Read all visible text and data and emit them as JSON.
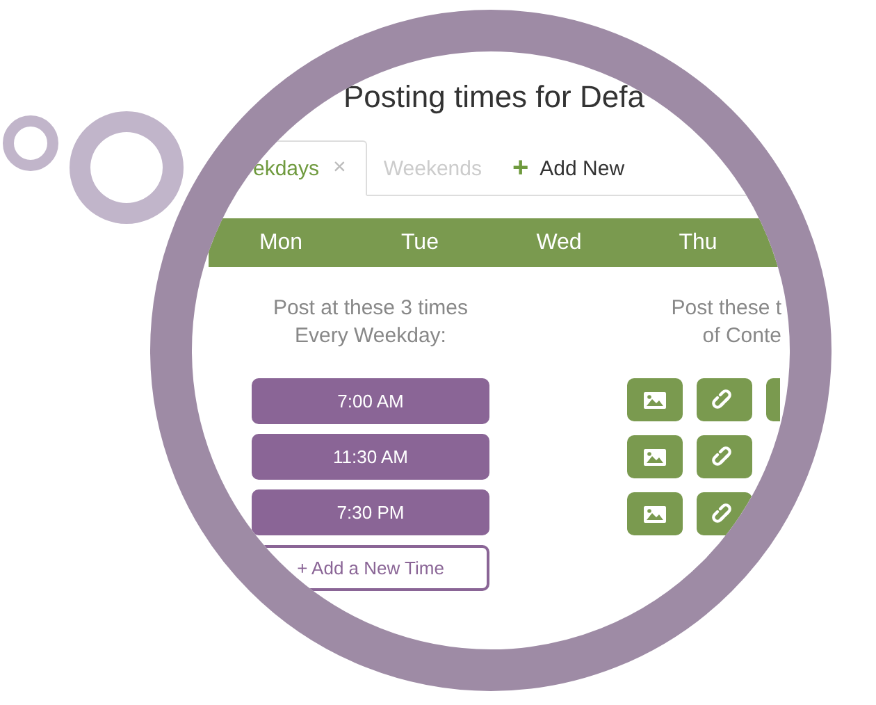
{
  "title": "Posting times for Defa",
  "tabs": [
    {
      "label": "ekdays",
      "selected": true,
      "closable": true,
      "close": "×"
    },
    {
      "label": "Weekends",
      "selected": false,
      "closable": false
    }
  ],
  "add_tab": {
    "icon": "+",
    "label": "Add New"
  },
  "days": [
    "Mon",
    "Tue",
    "Wed",
    "Thu"
  ],
  "times_panel": {
    "heading": [
      "Post at these 3 times",
      "Every Weekday:"
    ],
    "times": [
      "7:00 AM",
      "11:30 AM",
      "7:30 PM"
    ],
    "add_button": "+ Add a New Time"
  },
  "content_panel": {
    "heading": [
      "Post these t",
      "of Conte"
    ],
    "rows": [
      [
        {
          "kind": "image"
        },
        {
          "kind": "link"
        },
        {
          "kind": "blank"
        }
      ],
      [
        {
          "kind": "image"
        },
        {
          "kind": "link"
        }
      ],
      [
        {
          "kind": "image"
        },
        {
          "kind": "link"
        }
      ]
    ]
  }
}
